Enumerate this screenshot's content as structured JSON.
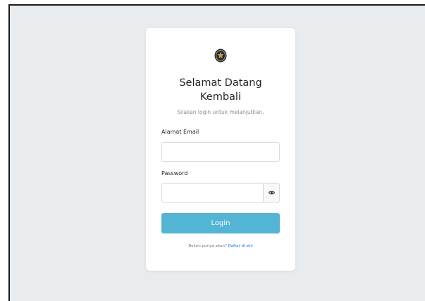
{
  "card": {
    "title_line1": "Selamat Datang",
    "title_line2": "Kembali",
    "subtitle": "Silakan login untuk melanjutkan."
  },
  "form": {
    "email_label": "Alamat Email",
    "email_value": "",
    "password_label": "Password",
    "password_value": "",
    "login_label": "Login"
  },
  "footer": {
    "prompt": "Belum punya akun?",
    "link": "Daftar di sini"
  },
  "icons": {
    "logo": "emblem-logo-icon",
    "toggle": "eye-icon"
  },
  "colors": {
    "background": "#e9ecef",
    "button": "#54b4d3",
    "link": "#0d6efd"
  }
}
